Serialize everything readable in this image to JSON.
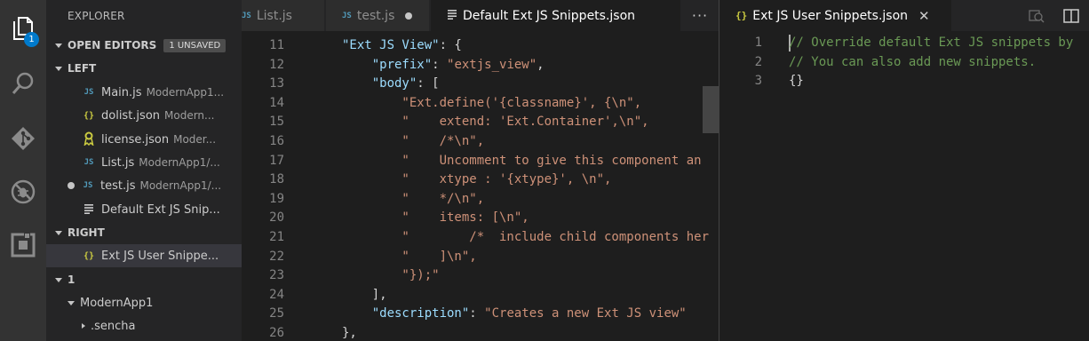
{
  "activity_bar": {
    "items": [
      "explorer-icon",
      "search-icon",
      "source-control-icon",
      "debug-icon",
      "extensions-icon"
    ],
    "explorer_badge": "1"
  },
  "sidebar": {
    "title": "EXPLORER",
    "open_editors_label": "OPEN EDITORS",
    "unsaved_badge": "1 UNSAVED",
    "groups": [
      {
        "name": "LEFT",
        "files": [
          {
            "icon": "JS",
            "name": "Main.js",
            "desc": "ModernApp1..."
          },
          {
            "icon": "{}",
            "name": "dolist.json",
            "desc": "Modern..."
          },
          {
            "icon": "license",
            "name": "license.json",
            "desc": "Moder..."
          },
          {
            "icon": "JS",
            "name": "List.js",
            "desc": "ModernApp1/..."
          },
          {
            "icon": "JS",
            "name": "test.js",
            "desc": "ModernApp1/...",
            "unsaved": true
          },
          {
            "icon": "lines",
            "name": "Default Ext JS Snip...",
            "desc": ""
          }
        ]
      },
      {
        "name": "RIGHT",
        "files": [
          {
            "icon": "{}",
            "name": "Ext JS User Snippe...",
            "desc": "",
            "selected": true
          }
        ]
      }
    ],
    "workspace_section": "1",
    "tree": [
      {
        "name": "ModernApp1",
        "expanded": true
      },
      {
        "name": ".sencha",
        "expanded": false
      }
    ]
  },
  "left_tabs": [
    {
      "icon": "JS",
      "label": "List.js"
    },
    {
      "icon": "JS",
      "label": "test.js",
      "dirty": true
    },
    {
      "icon": "lines",
      "label": "Default Ext JS Snippets.json",
      "active": true
    }
  ],
  "more_label": "···",
  "left_editor": {
    "lines": [
      {
        "num": "11",
        "tokens": [
          {
            "t": "k",
            "v": "\"Ext JS View\""
          },
          {
            "t": "p",
            "v": ": {"
          }
        ]
      },
      {
        "num": "12",
        "tokens": [
          {
            "t": "p",
            "v": "    "
          },
          {
            "t": "k",
            "v": "\"prefix\""
          },
          {
            "t": "p",
            "v": ": "
          },
          {
            "t": "s",
            "v": "\"extjs_view\""
          },
          {
            "t": "p",
            "v": ","
          }
        ]
      },
      {
        "num": "13",
        "tokens": [
          {
            "t": "p",
            "v": "    "
          },
          {
            "t": "k",
            "v": "\"body\""
          },
          {
            "t": "p",
            "v": ": ["
          }
        ]
      },
      {
        "num": "14",
        "tokens": [
          {
            "t": "s",
            "v": "        \"Ext.define('{classname}', {\\n\","
          }
        ]
      },
      {
        "num": "15",
        "tokens": [
          {
            "t": "s",
            "v": "        \"    extend: 'Ext.Container',\\n\","
          }
        ]
      },
      {
        "num": "16",
        "tokens": [
          {
            "t": "s",
            "v": "        \"    /*\\n\","
          }
        ]
      },
      {
        "num": "17",
        "tokens": [
          {
            "t": "s",
            "v": "        \"    Uncomment to give this component an"
          }
        ]
      },
      {
        "num": "18",
        "tokens": [
          {
            "t": "s",
            "v": "        \"    xtype : '{xtype}', \\n\","
          }
        ]
      },
      {
        "num": "19",
        "tokens": [
          {
            "t": "s",
            "v": "        \"    */\\n\","
          }
        ]
      },
      {
        "num": "20",
        "tokens": [
          {
            "t": "s",
            "v": "        \"    items: [\\n\","
          }
        ]
      },
      {
        "num": "21",
        "tokens": [
          {
            "t": "s",
            "v": "        \"        /*  include child components her"
          }
        ]
      },
      {
        "num": "22",
        "tokens": [
          {
            "t": "s",
            "v": "        \"    ]\\n\","
          }
        ]
      },
      {
        "num": "23",
        "tokens": [
          {
            "t": "s",
            "v": "        \"});\""
          }
        ]
      },
      {
        "num": "24",
        "tokens": [
          {
            "t": "p",
            "v": "    ],"
          }
        ]
      },
      {
        "num": "25",
        "tokens": [
          {
            "t": "p",
            "v": "    "
          },
          {
            "t": "k",
            "v": "\"description\""
          },
          {
            "t": "p",
            "v": ": "
          },
          {
            "t": "s",
            "v": "\"Creates a new Ext JS view\""
          }
        ]
      },
      {
        "num": "26",
        "tokens": [
          {
            "t": "p",
            "v": "},"
          }
        ]
      }
    ]
  },
  "right_tab": {
    "icon": "{}",
    "label": "Ext JS User Snippets.json"
  },
  "right_editor": {
    "lines": [
      {
        "num": "1",
        "tokens": [
          {
            "t": "c",
            "v": "// Override default Ext JS snippets by"
          }
        ]
      },
      {
        "num": "2",
        "tokens": [
          {
            "t": "c",
            "v": "// You can also add new snippets."
          }
        ]
      },
      {
        "num": "3",
        "tokens": [
          {
            "t": "p",
            "v": "{}"
          }
        ]
      }
    ]
  }
}
